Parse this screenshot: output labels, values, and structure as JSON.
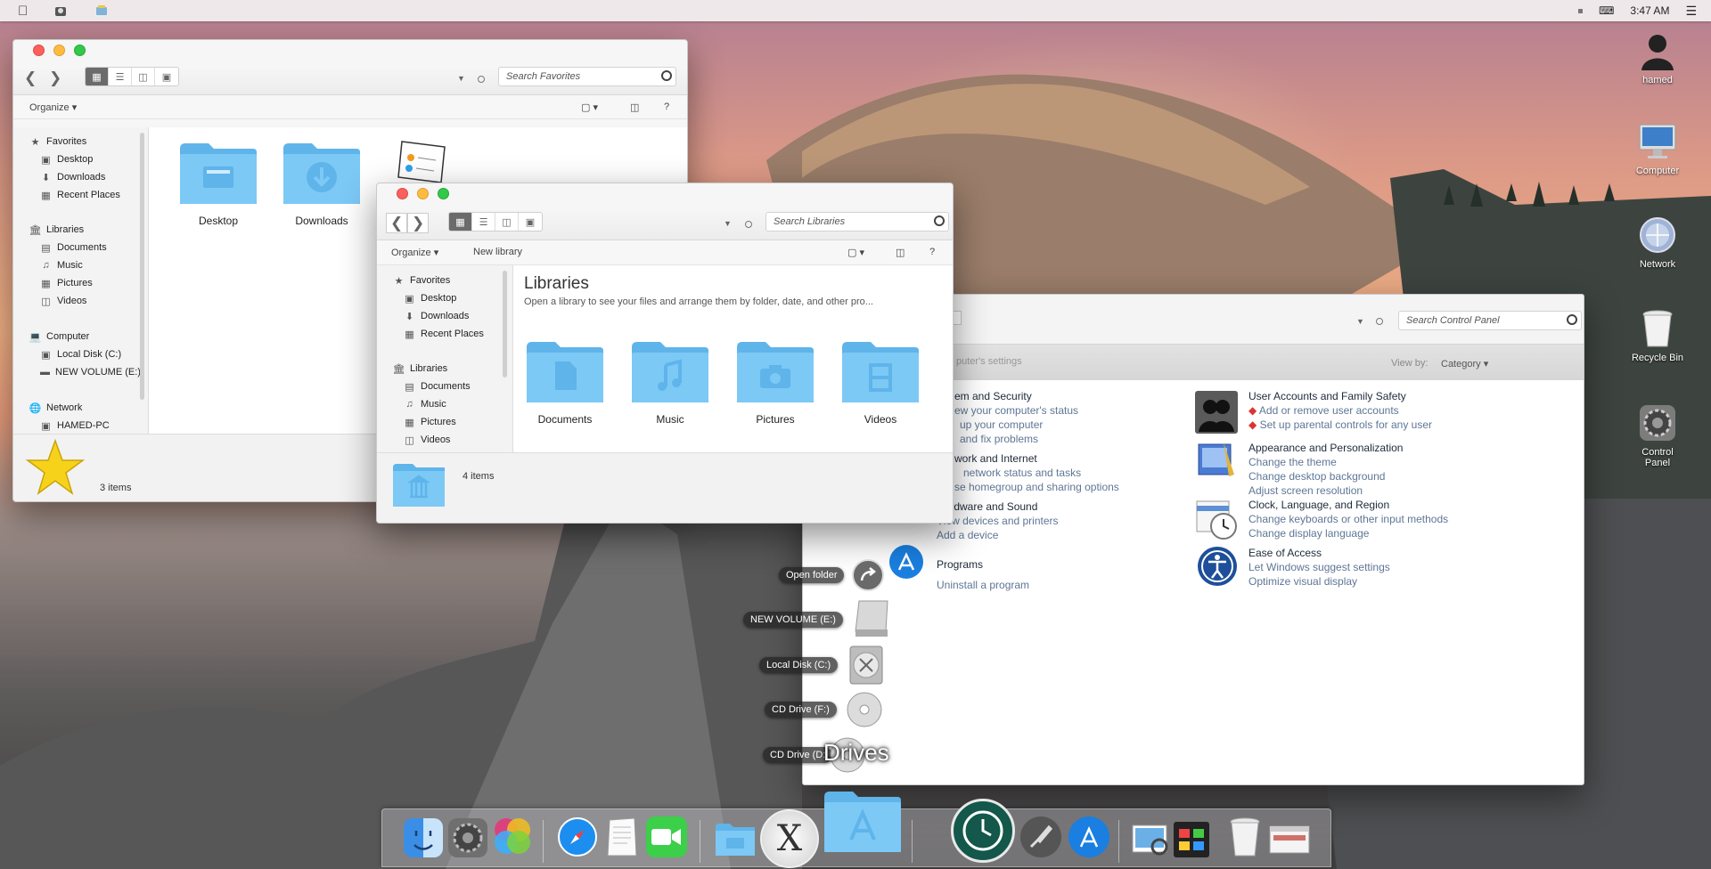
{
  "menubar": {
    "apple_icon": "apple-icon",
    "app_icons": [
      "finder-person-icon",
      "network-drive-icon"
    ],
    "time": "3:47 AM",
    "status_icons": [
      "dot-icon",
      "keyboard-icon",
      "list-icon"
    ]
  },
  "favorites_window": {
    "search_placeholder": "Search Favorites",
    "organize": "Organize",
    "sidebar": {
      "favorites": "Favorites",
      "desktop": "Desktop",
      "downloads": "Downloads",
      "recent_places": "Recent Places",
      "libraries": "Libraries",
      "documents": "Documents",
      "music": "Music",
      "pictures": "Pictures",
      "videos": "Videos",
      "computer": "Computer",
      "local_disk": "Local Disk (C:)",
      "new_volume": "NEW VOLUME (E:)",
      "network": "Network",
      "hamed_pc": "HAMED-PC"
    },
    "items": [
      "Desktop",
      "Downloads"
    ],
    "status": "3 items"
  },
  "libraries_window": {
    "search_placeholder": "Search Libraries",
    "organize": "Organize",
    "new_library": "New library",
    "sidebar": {
      "favorites": "Favorites",
      "desktop": "Desktop",
      "downloads": "Downloads",
      "recent_places": "Recent Places",
      "libraries": "Libraries",
      "documents": "Documents",
      "music": "Music",
      "pictures": "Pictures",
      "videos": "Videos"
    },
    "heading": "Libraries",
    "subheading": "Open a library to see your files and arrange them by folder, date, and other pro...",
    "items": [
      "Documents",
      "Music",
      "Pictures",
      "Videos"
    ],
    "status": "4 items"
  },
  "control_panel": {
    "search_placeholder": "Search Control Panel",
    "adjust_text": "puter's settings",
    "view_by_label": "View by:",
    "view_by_value": "Category",
    "left": [
      {
        "title": "em and Security",
        "links": [
          "ew your computer's status",
          "up your computer",
          "and fix problems"
        ]
      },
      {
        "title": "work and Internet",
        "links": [
          "network status and tasks",
          "se homegroup and sharing options"
        ]
      },
      {
        "title": "Hardware and Sound",
        "links": [
          "View devices and printers",
          "Add a device"
        ]
      },
      {
        "title": "Programs",
        "links": [
          "Uninstall a program"
        ]
      }
    ],
    "right": [
      {
        "title": "User Accounts and Family Safety",
        "links": [
          "Add or remove user accounts",
          "Set up parental controls for any user"
        ]
      },
      {
        "title": "Appearance and Personalization",
        "links": [
          "Change the theme",
          "Change desktop background",
          "Adjust screen resolution"
        ]
      },
      {
        "title": "Clock, Language, and Region",
        "links": [
          "Change keyboards or other input methods",
          "Change display language"
        ]
      },
      {
        "title": "Ease of Access",
        "links": [
          "Let Windows suggest settings",
          "Optimize visual display"
        ]
      }
    ]
  },
  "drives_stack": {
    "open_folder": "Open folder",
    "new_volume": "NEW VOLUME (E:)",
    "local_disk": "Local Disk (C:)",
    "cd_drive_f": "CD Drive (F:)",
    "cd_drive_d": "CD Drive (D:",
    "label": "Drives"
  },
  "desktop_icons": [
    {
      "label": "hamed",
      "icon": "user-icon"
    },
    {
      "label": "Computer",
      "icon": "computer-icon"
    },
    {
      "label": "Network",
      "icon": "network-icon"
    },
    {
      "label": "Recycle Bin",
      "icon": "recycle-bin-icon"
    },
    {
      "label": "Control Panel",
      "icon": "control-panel-icon"
    }
  ],
  "dock": {
    "icons": [
      "finder-icon",
      "system-preferences-icon",
      "game-center-icon",
      "safari-icon",
      "textedit-icon",
      "facetime-icon",
      "folder-icon",
      "osx-icon",
      "app-store-folder-icon",
      "time-machine-icon",
      "launchpad-icon",
      "app-store-icon",
      "preview-icon",
      "photo-booth-icon",
      "trash-icon",
      "window-icon"
    ]
  }
}
